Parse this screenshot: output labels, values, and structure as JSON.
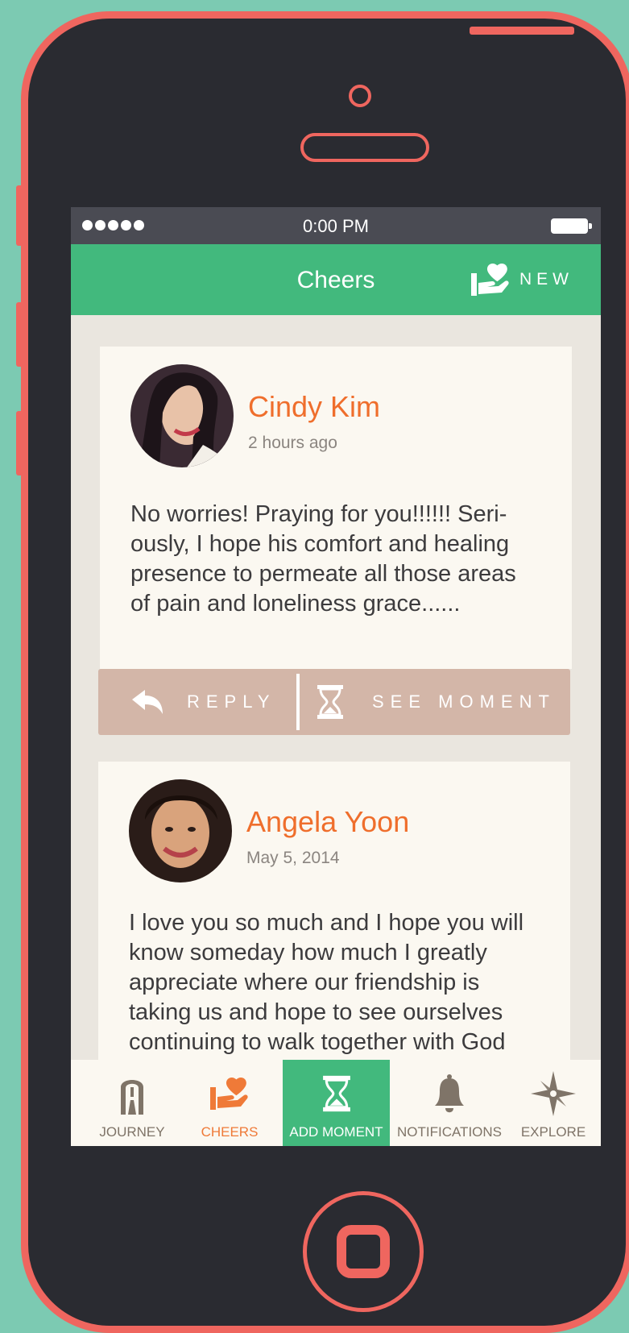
{
  "status_bar": {
    "time": "0:00 PM"
  },
  "header": {
    "title": "Cheers",
    "new_label": "NEW"
  },
  "posts": [
    {
      "author": "Cindy Kim",
      "time": "2 hours ago",
      "message": "No worries! Praying for you!!!!!! Seri-ously, I hope his comfort and healing presence to permeate all those areas of pain and loneliness grace......",
      "actions": {
        "reply": "REPLY",
        "see_moment": "SEE MOMENT"
      }
    },
    {
      "author": "Angela Yoon",
      "time": "May 5, 2014",
      "message": "I love you so much and I hope you will know someday how much I greatly appreciate where our friendship is taking us and hope to see ourselves continuing to walk together with God"
    }
  ],
  "tabs": [
    {
      "label": "JOURNEY",
      "icon": "lighthouse-icon"
    },
    {
      "label": "CHEERS",
      "icon": "heart-hand-icon",
      "active": true
    },
    {
      "label": "ADD MOMENT",
      "icon": "hourglass-icon"
    },
    {
      "label": "NOTIFICATIONS",
      "icon": "bell-icon"
    },
    {
      "label": "EXPLORE",
      "icon": "compass-star-icon"
    }
  ],
  "colors": {
    "background": "#7ccab2",
    "phone_frame": "#ef665f",
    "accent_green": "#42b97d",
    "accent_orange": "#ef6e2c",
    "action_bar": "#d3b6a8"
  }
}
